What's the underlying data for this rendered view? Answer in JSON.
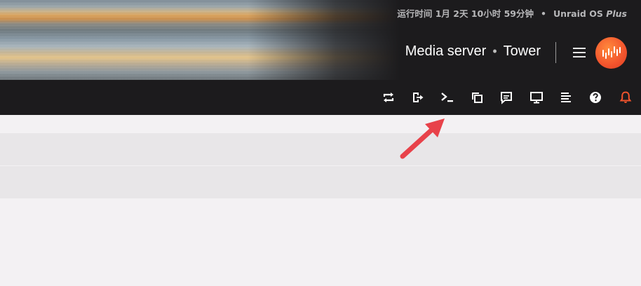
{
  "header": {
    "uptime_label": "运行时间 1月 2天 10小时 59分钟",
    "separator": "•",
    "os_name": "Unraid OS",
    "os_edition": "Plus",
    "server_description": "Media server",
    "server_name": "Tower"
  },
  "toolbar": {
    "icons": [
      "switch-icon",
      "logout-icon",
      "terminal-icon",
      "copy-windows-icon",
      "feedback-icon",
      "monitor-icon",
      "log-icon",
      "help-icon",
      "notification-bell-icon"
    ]
  },
  "colors": {
    "header_bg": "#1c1b1d",
    "accent": "#f2542d",
    "page_bg": "#f3f1f3",
    "row_bg": "#e8e6e8",
    "annotation_arrow": "#e8424a"
  }
}
